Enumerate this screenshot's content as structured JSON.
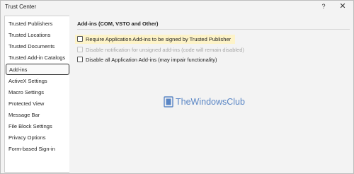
{
  "window": {
    "title": "Trust Center",
    "help_label": "?",
    "close_label": "✕"
  },
  "sidebar": {
    "items": [
      {
        "label": "Trusted Publishers"
      },
      {
        "label": "Trusted Locations"
      },
      {
        "label": "Trusted Documents"
      },
      {
        "label": "Trusted Add-in Catalogs"
      },
      {
        "label": "Add-ins",
        "selected": true
      },
      {
        "label": "ActiveX Settings"
      },
      {
        "label": "Macro Settings"
      },
      {
        "label": "Protected View"
      },
      {
        "label": "Message Bar"
      },
      {
        "label": "File Block Settings"
      },
      {
        "label": "Privacy Options"
      },
      {
        "label": "Form-based Sign-in"
      }
    ]
  },
  "main": {
    "section_title": "Add-ins (COM, VSTO and Other)",
    "options": [
      {
        "label": "Require Application Add-ins to be signed by Trusted Publisher",
        "checked": false,
        "enabled": true,
        "highlighted": true
      },
      {
        "label": "Disable notification for unsigned add-ins (code will remain disabled)",
        "checked": false,
        "enabled": false
      },
      {
        "label": "Disable all Application Add-ins (may impair functionality)",
        "checked": false,
        "enabled": true
      }
    ]
  },
  "watermark": {
    "text": "TheWindowsClub",
    "color": "#5a86c5"
  }
}
